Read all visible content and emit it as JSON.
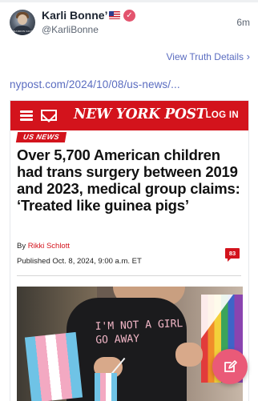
{
  "post": {
    "display_name": "Karli Bonne’",
    "handle": "@KarliBonne",
    "time_ago": "6m",
    "view_details_label": "View Truth Details",
    "link_text": "nypost.com/2024/10/08/us-news/...",
    "avatar_caption": "BRANDON FANS"
  },
  "card": {
    "masthead": "NEW YORK POST",
    "login_label": "LOG IN",
    "section_tag": "US NEWS",
    "headline": "Over 5,700 American children had trans surgery between 2019 and 2023, medical group claims: ‘Treated like guinea pigs’",
    "byline_prefix": "By ",
    "author": "Rikki Schlott",
    "published": "Published Oct. 8, 2024, 9:00 a.m. ET",
    "comment_count": "83",
    "photo_shirt_text": "I'M NOT A GIRL\nGO AWAY"
  },
  "colors": {
    "accent_link": "#5a6cc0",
    "nyp_red": "#d3131c",
    "fab": "#ea5a78"
  },
  "icons": {
    "verified": "verified-badge-icon",
    "flag": "us-flag-icon",
    "menu": "hamburger-icon",
    "mail": "mail-icon",
    "chevron": "chevron-right-icon",
    "compose": "compose-icon"
  }
}
